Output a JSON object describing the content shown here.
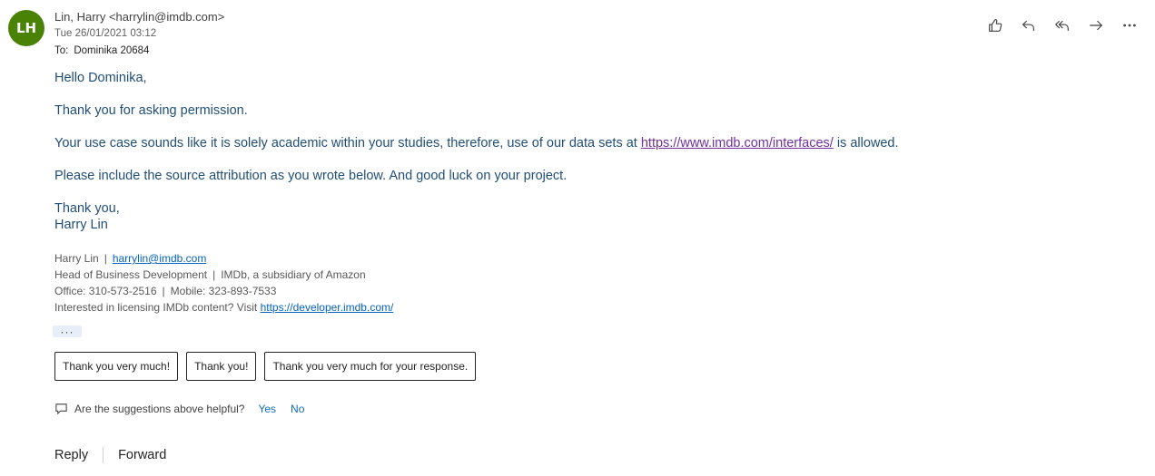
{
  "header": {
    "avatar_initials": "LH",
    "avatar_color": "#498205",
    "sender": "Lin, Harry <harrylin@imdb.com>",
    "date": "Tue 26/01/2021 03:12",
    "to_label": "To:",
    "to_value": "Dominika 20684"
  },
  "actions": [
    {
      "icon": "like-icon"
    },
    {
      "icon": "reply-icon"
    },
    {
      "icon": "reply-all-icon"
    },
    {
      "icon": "forward-icon"
    },
    {
      "icon": "more-actions-icon"
    }
  ],
  "body": {
    "greeting": "Hello Dominika,",
    "para1": "Thank you for asking permission.",
    "para2_before": "Your use case sounds like it is solely academic within your studies, therefore, use of our data sets at ",
    "para2_link": "https://www.imdb.com/interfaces/",
    "para2_after": " is allowed.",
    "para3": "Please include the source attribution as you wrote below. And good luck on your project.",
    "closing": "Thank you,",
    "name": "Harry Lin"
  },
  "signature": {
    "name": "Harry Lin",
    "separator": "|",
    "email": "harrylin@imdb.com",
    "title": "Head of Business Development",
    "company": "IMDb, a subsidiary of Amazon",
    "office": "Office: 310-573-2516",
    "mobile": "Mobile: 323-893-7533",
    "licensing_text": "Interested in licensing IMDb content? Visit ",
    "licensing_link": "https://developer.imdb.com/"
  },
  "more_label": "···",
  "suggestions": [
    "Thank you very much!",
    "Thank you!",
    "Thank you very much for your response."
  ],
  "feedback": {
    "question": "Are the suggestions above helpful?",
    "yes": "Yes",
    "no": "No"
  },
  "reply_bar": {
    "reply": "Reply",
    "forward": "Forward"
  }
}
